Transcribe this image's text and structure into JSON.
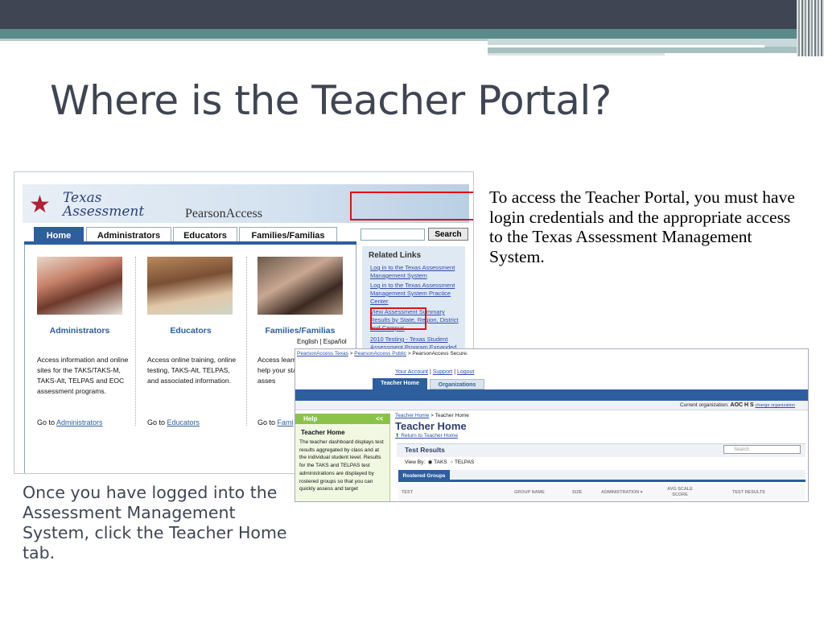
{
  "slide": {
    "title": "Where is the Teacher Portal?",
    "right_text": "To access the Teacher Portal, you must have login credentials and the appropriate access to the Texas Assessment Management System.",
    "left_text": "Once you have logged into the Assessment Management System, click the Teacher Home tab."
  },
  "shot1": {
    "logo_line1": "Texas",
    "logo_line2": "Assessment",
    "brand": "PearsonAccess",
    "tabs": [
      "Home",
      "Administrators",
      "Educators",
      "Families/Familias"
    ],
    "search_button": "Search",
    "columns": [
      {
        "heading": "Administrators",
        "description": "Access information and online sites for the TAKS/TAKS-M, TAKS-Alt, TELPAS and EOC assessment programs.",
        "go_to": "Go to",
        "link": "Administrators"
      },
      {
        "heading": "Educators",
        "description": "Access online training, online testing, TAKS-Alt, TELPAS, and associated information.",
        "go_to": "Go to",
        "link": "Educators"
      },
      {
        "heading": "Families/Familias",
        "description": "Access learn to help your state asses",
        "go_to": "Go to",
        "link": "Fami"
      }
    ],
    "language": "English | Español",
    "related_heading": "Related Links",
    "related_links": [
      "Log in to the Texas Assessment Management System",
      "Log in to the Texas Assessment Management System Practice Center",
      "View Assessment Summary Results by State, Region, District and Campus",
      "2010 Testing - Texas Student Assessment Program Expanded"
    ]
  },
  "shot2": {
    "breadcrumb": [
      "PearsonAccess Texas",
      "PearsonAccess Public",
      "PearsonAccess Secure."
    ],
    "account_links": [
      "Your Account",
      "Support",
      "Logout"
    ],
    "tabs": [
      "Teacher Home",
      "Organizations"
    ],
    "current_org_label": "Current organization:",
    "current_org": "AOC H S",
    "change_org": "change organization",
    "help_title": "Help",
    "help_collapse": "<<",
    "help_heading": "Teacher Home",
    "help_text": "The teacher dashboard displays test results aggregated by class and at the individual student level. Results for the TAKS and TELPAS test administrations are displayed by rostered groups so that you can quickly assess and target",
    "page_crumb_link": "Teacher Home",
    "page_crumb_current": "Teacher Home",
    "page_title": "Teacher Home",
    "return_link": "Return to Teacher Home",
    "section_title": "Test Results",
    "search_placeholder": "Search",
    "view_by_label": "View By:",
    "view_options": [
      "TAKS",
      "TELPAS"
    ],
    "rostered_groups": "Rostered Groups",
    "table_headers": [
      "TEST",
      "GROUP NAME",
      "SIZE",
      "ADMINISTRATION",
      "AVG SCALE SCORE",
      "TEST RESULTS"
    ]
  }
}
